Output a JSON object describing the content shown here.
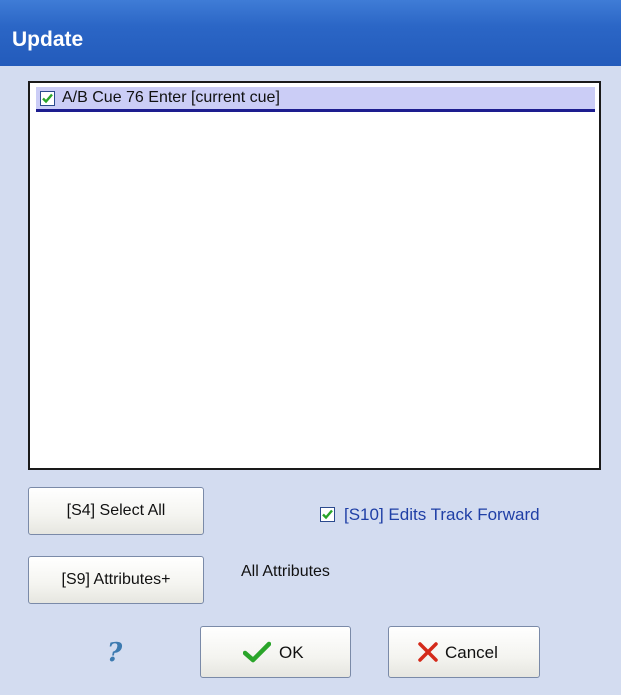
{
  "window": {
    "title": "Update"
  },
  "list": {
    "items": [
      {
        "label": "A/B Cue 76 Enter [current cue]",
        "checked": true
      }
    ]
  },
  "buttons": {
    "select_all": "[S4] Select All",
    "attributes": "[S9] Attributes+",
    "ok": "OK",
    "cancel": "Cancel"
  },
  "track_forward": {
    "label": "[S10] Edits Track Forward",
    "checked": true
  },
  "attributes_value": "All Attributes",
  "help": {
    "glyph": "?",
    "icon": "help-icon"
  },
  "colors": {
    "title_bar": "#2b66c6",
    "dialog_bg": "#d3dcf0",
    "selection": "#cbcdf6",
    "check": "#2aa52a",
    "cancel_x": "#d42a1a",
    "link_text": "#1f3fa6"
  }
}
